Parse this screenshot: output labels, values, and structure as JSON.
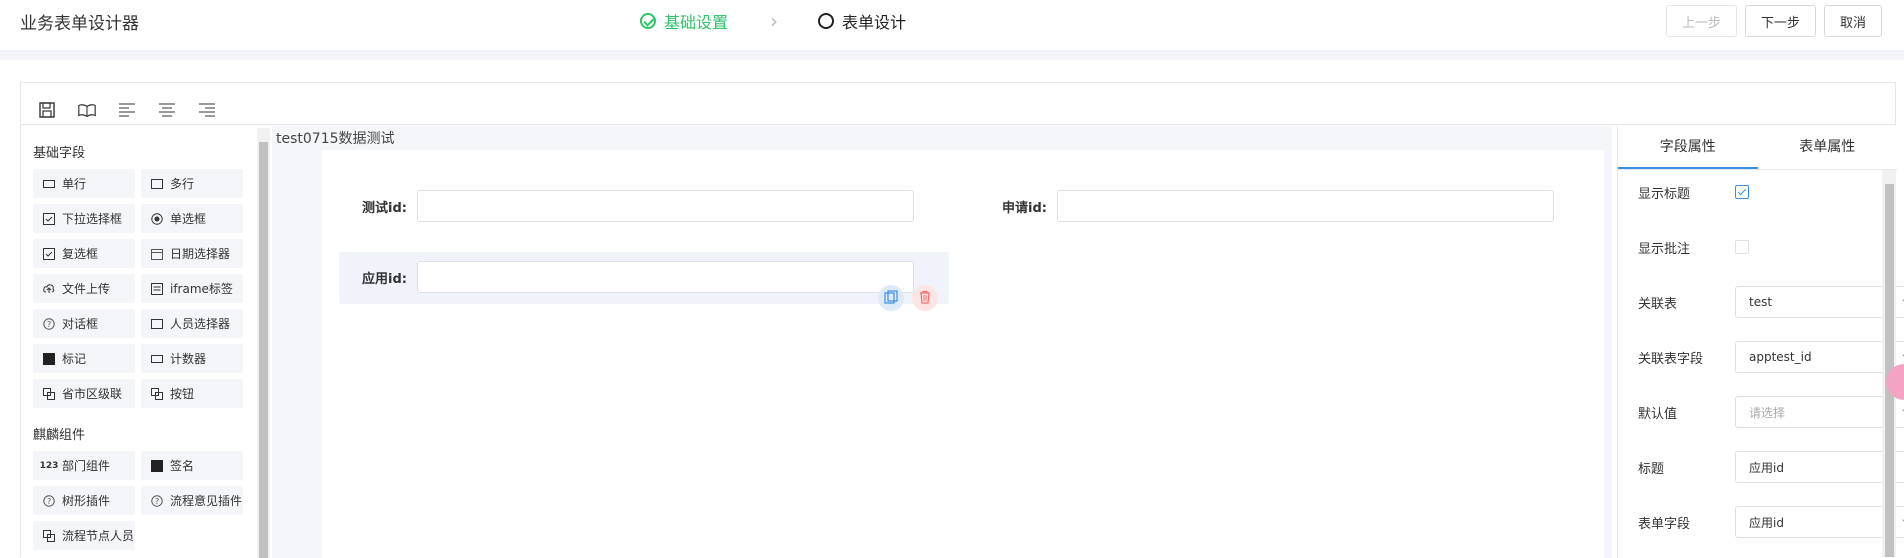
{
  "header": {
    "title": "业务表单设计器",
    "steps": [
      {
        "label": "基础设置",
        "status": "done"
      },
      {
        "label": "表单设计",
        "status": "current"
      }
    ],
    "buttons": {
      "prev": "上一步",
      "next": "下一步",
      "cancel": "取消"
    }
  },
  "toolbar": {
    "icons": [
      "save-icon",
      "preview-book-icon",
      "align-left-icon",
      "align-center-icon",
      "align-right-icon"
    ]
  },
  "left_panel": {
    "groups": [
      {
        "title": "基础字段",
        "items": [
          {
            "label": "单行",
            "icon": "single-line-icon"
          },
          {
            "label": "多行",
            "icon": "multi-line-icon"
          },
          {
            "label": "下拉选择框",
            "icon": "dropdown-icon"
          },
          {
            "label": "单选框",
            "icon": "radio-icon"
          },
          {
            "label": "复选框",
            "icon": "checkbox-icon"
          },
          {
            "label": "日期选择器",
            "icon": "calendar-icon"
          },
          {
            "label": "文件上传",
            "icon": "upload-icon"
          },
          {
            "label": "iframe标签",
            "icon": "iframe-icon"
          },
          {
            "label": "对话框",
            "icon": "dialog-icon"
          },
          {
            "label": "人员选择器",
            "icon": "person-select-icon"
          },
          {
            "label": "标记",
            "icon": "mark-icon"
          },
          {
            "label": "计数器",
            "icon": "counter-icon"
          },
          {
            "label": "省市区级联",
            "icon": "cascade-icon"
          },
          {
            "label": "按钮",
            "icon": "button-icon"
          }
        ]
      },
      {
        "title": "麒麟组件",
        "items": [
          {
            "label": "部门组件",
            "icon": "dept-icon"
          },
          {
            "label": "签名",
            "icon": "signature-icon"
          },
          {
            "label": "树形插件",
            "icon": "tree-icon"
          },
          {
            "label": "流程意见插件",
            "icon": "opinion-icon"
          },
          {
            "label": "流程节点人员",
            "icon": "node-person-icon"
          }
        ]
      }
    ]
  },
  "canvas": {
    "form_name": "test0715数据测试",
    "fields": [
      {
        "label": "测试id:",
        "value": ""
      },
      {
        "label": "申请id:",
        "value": ""
      },
      {
        "label": "应用id:",
        "value": ""
      }
    ]
  },
  "right_panel": {
    "tabs": [
      {
        "label": "字段属性",
        "active": true
      },
      {
        "label": "表单属性",
        "active": false
      }
    ],
    "props": {
      "show_title": {
        "label": "显示标题",
        "checked": true
      },
      "show_comment": {
        "label": "显示批注",
        "checked": false
      },
      "rel_table": {
        "label": "关联表",
        "value": "test"
      },
      "rel_field": {
        "label": "关联表字段",
        "value": "apptest_id"
      },
      "default_value": {
        "label": "默认值",
        "placeholder": "请选择"
      },
      "title": {
        "label": "标题",
        "value": "应用id"
      },
      "form_field": {
        "label": "表单字段",
        "value": "应用id"
      }
    }
  },
  "colors": {
    "accent": "#3a8ee6",
    "success": "#2ec26a",
    "danger": "#f56c6c"
  }
}
